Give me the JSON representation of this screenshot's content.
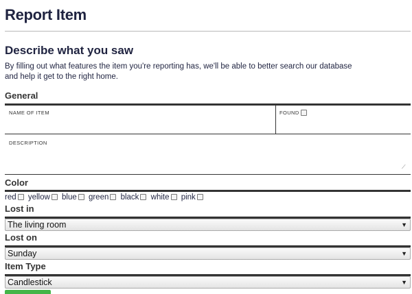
{
  "page": {
    "title": "Report Item",
    "section_title": "Describe what you saw",
    "intro_line1": "By filling out what features the item you're reporting has, we'll be able to better search our database",
    "intro_line2": "and help it get to the right home."
  },
  "general": {
    "label": "General",
    "name_label": "NAME OF ITEM",
    "name_value": "",
    "found_label": "FOUND",
    "found_checked": false,
    "description_label": "DESCRIPTION",
    "description_value": ""
  },
  "color": {
    "label": "Color",
    "options": [
      "red",
      "yellow",
      "blue",
      "green",
      "black",
      "white",
      "pink"
    ]
  },
  "lost_in": {
    "label": "Lost in",
    "value": "The living room"
  },
  "lost_on": {
    "label": "Lost on",
    "value": "Sunday"
  },
  "item_type": {
    "label": "Item Type",
    "value": "Candlestick"
  },
  "colors": {
    "text": "#1f2340",
    "rule": "#333333",
    "submit": "#44b548"
  }
}
